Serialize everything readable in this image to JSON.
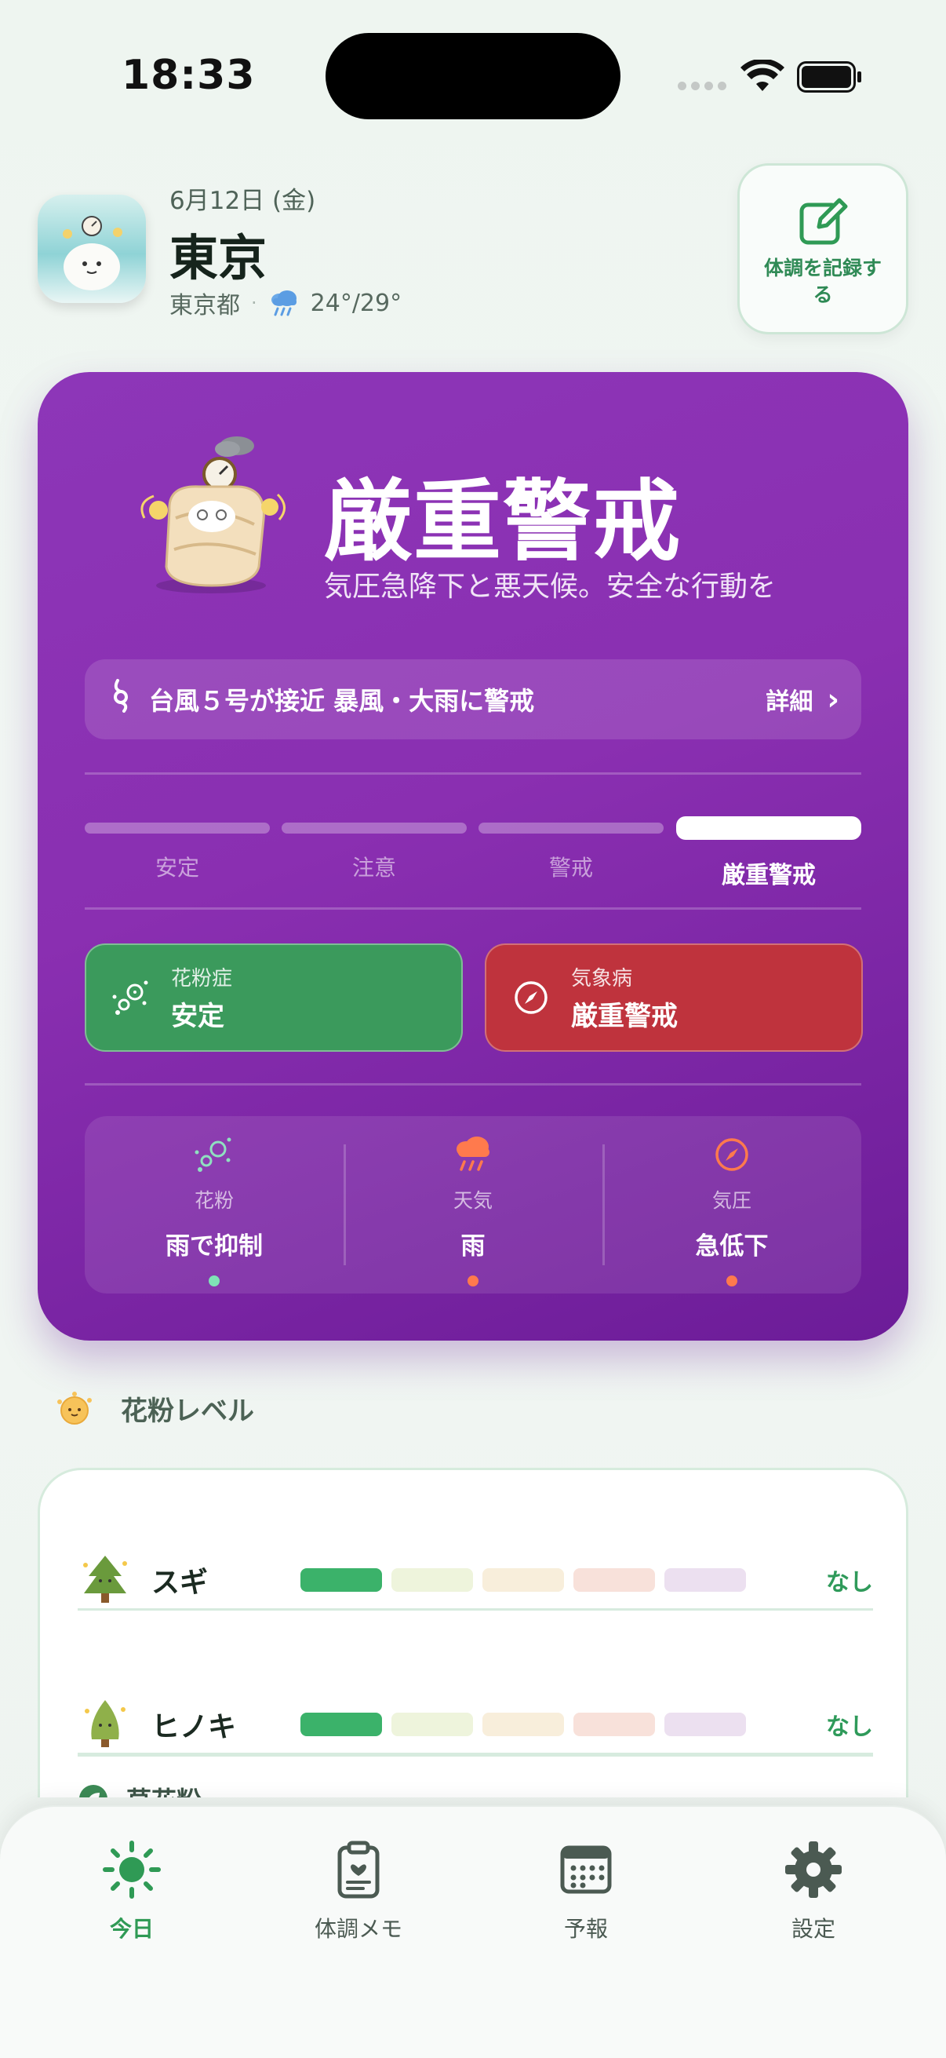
{
  "status_bar": {
    "time": "18:33"
  },
  "header": {
    "date": "6月12日 (金)",
    "city": "東京",
    "prefecture": "東京都",
    "separator": "·",
    "temperature": "24°/29°",
    "record_button_label": "体調を記録する"
  },
  "alert": {
    "title": "厳重警戒",
    "description": "気圧急降下と悪天候。安全な行動を",
    "typhoon": {
      "text": "台風５号が接近 暴風・大雨に警戒",
      "detail_label": "詳細",
      "chevron": "›"
    },
    "levels": [
      "安定",
      "注意",
      "警戒",
      "厳重警戒"
    ],
    "current_level": 3,
    "pills": [
      {
        "sub": "花粉症",
        "main": "安定"
      },
      {
        "sub": "気象病",
        "main": "厳重警戒"
      }
    ],
    "factors": [
      {
        "label": "花粉",
        "value": "雨で抑制",
        "dot_color": "#7fe3b6"
      },
      {
        "label": "天気",
        "value": "雨",
        "dot_color": "#ff7a4d"
      },
      {
        "label": "気圧",
        "value": "急低下",
        "dot_color": "#ff7a4d"
      }
    ]
  },
  "pollen": {
    "heading": "花粉レベル",
    "rows": [
      {
        "name": "スギ",
        "status": "なし",
        "level": 1
      },
      {
        "name": "ヒノキ",
        "status": "なし",
        "level": 1
      }
    ],
    "peek_name": "草花粉",
    "bar_colors": [
      "#3bb26a",
      "#eef4dc",
      "#f8eedb",
      "#f8e1da",
      "#ece0f0"
    ]
  },
  "tabs": [
    {
      "label": "今日",
      "active": true
    },
    {
      "label": "体調メモ",
      "active": false
    },
    {
      "label": "予報",
      "active": false
    },
    {
      "label": "設定",
      "active": false
    }
  ],
  "colors": {
    "accent_green": "#2f9a55",
    "alert_purple": "#8a2fb1",
    "alert_red": "#bf333d",
    "pollen_green": "#3b9a5c"
  }
}
